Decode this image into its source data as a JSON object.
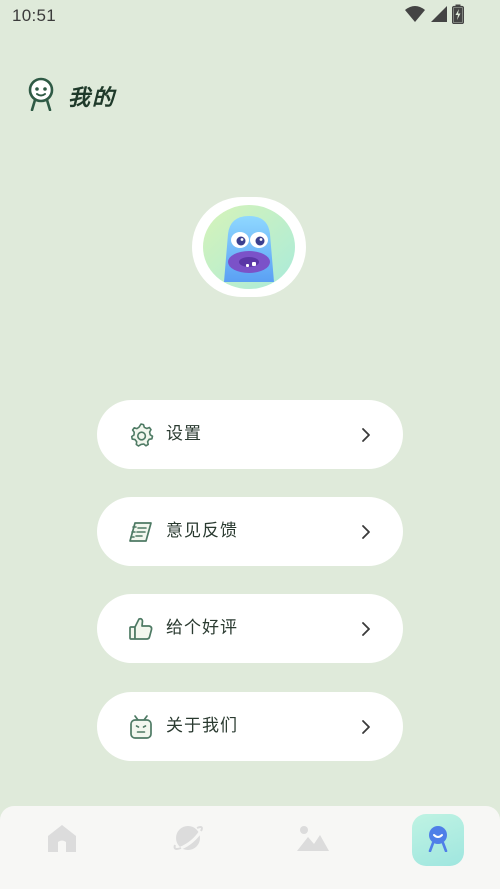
{
  "status_bar": {
    "time": "10:51"
  },
  "header": {
    "title": "我的",
    "icon": "smiley-person-icon"
  },
  "profile": {
    "avatar_icon": "blob-monster-avatar"
  },
  "menu": [
    {
      "label": "设置",
      "icon": "gear-icon"
    },
    {
      "label": "意见反馈",
      "icon": "feedback-notebook-icon"
    },
    {
      "label": "给个好评",
      "icon": "thumbs-up-icon"
    },
    {
      "label": "关于我们",
      "icon": "robot-face-icon"
    }
  ],
  "bottom_nav": {
    "items": [
      {
        "icon": "home-icon",
        "active": false
      },
      {
        "icon": "planet-icon",
        "active": false
      },
      {
        "icon": "image-icon",
        "active": false
      },
      {
        "icon": "profile-icon",
        "active": true
      }
    ]
  },
  "colors": {
    "background": "#dfeada",
    "card": "#ffffff",
    "text": "#2a3a30",
    "accent_green": "#4e7a64",
    "active_tab": "#a8ebe0"
  }
}
